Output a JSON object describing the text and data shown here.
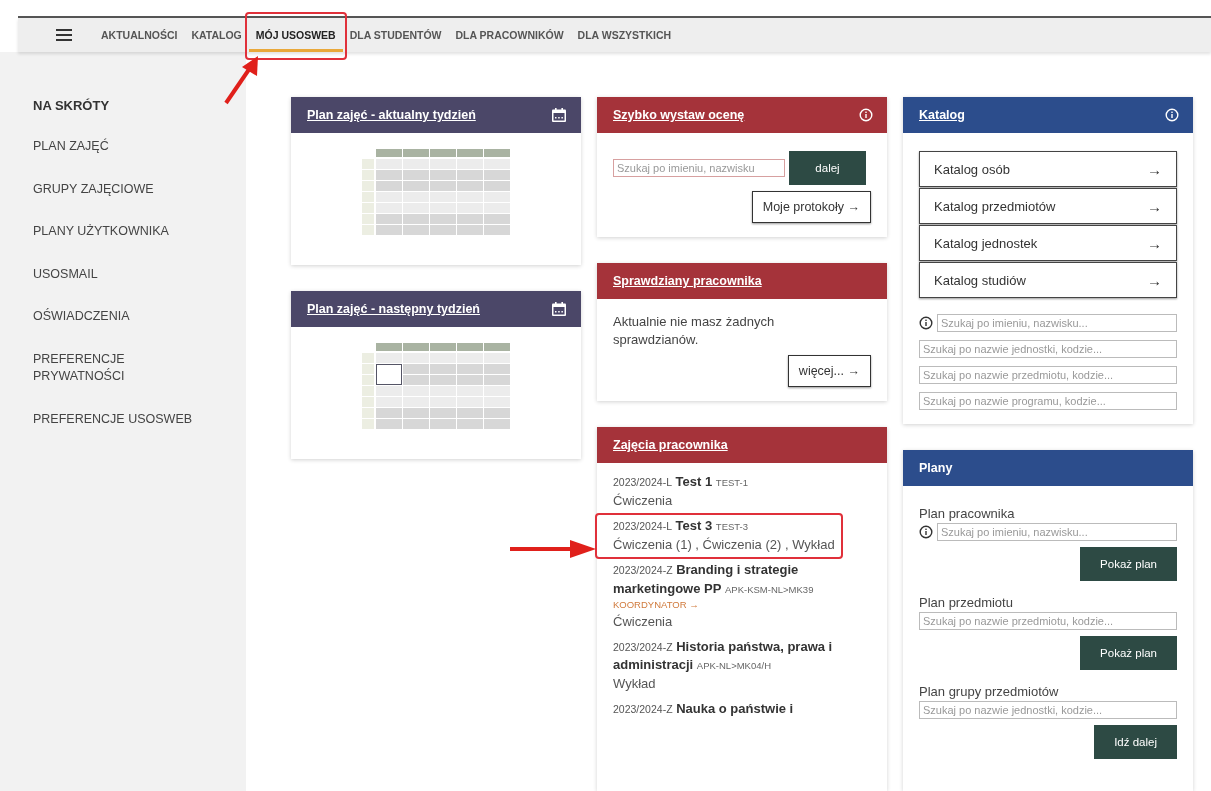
{
  "nav": {
    "items": [
      {
        "label": "AKTUALNOŚCI",
        "selected": false,
        "highlighted": false
      },
      {
        "label": "KATALOG",
        "selected": false,
        "highlighted": false
      },
      {
        "label": "MÓJ USOSWEB",
        "selected": true,
        "highlighted": true
      },
      {
        "label": "DLA STUDENTÓW",
        "selected": false,
        "highlighted": false
      },
      {
        "label": "DLA PRACOWNIKÓW",
        "selected": false,
        "highlighted": false
      },
      {
        "label": "DLA WSZYSTKICH",
        "selected": false,
        "highlighted": false
      }
    ]
  },
  "sidebar": {
    "items": [
      {
        "label": "NA SKRÓTY",
        "kind": "heading"
      },
      {
        "label": "PLAN ZAJĘĆ",
        "kind": "link"
      },
      {
        "label": "GRUPY ZAJĘCIOWE",
        "kind": "link"
      },
      {
        "label": "PLANY UŻYTKOWNIKA",
        "kind": "link"
      },
      {
        "label": "USOSMAIL",
        "kind": "link"
      },
      {
        "label": "OŚWIADCZENIA",
        "kind": "link"
      },
      {
        "label": "PREFERENCJE PRYWATNOŚCI",
        "kind": "link"
      },
      {
        "label": "PREFERENCJE USOSWEB",
        "kind": "link"
      }
    ]
  },
  "schedule_cards": [
    {
      "title": "Plan zajęć - aktualny tydzień",
      "has_event": false
    },
    {
      "title": "Plan zajęć - następny tydzień",
      "has_event": true
    }
  ],
  "quick_grade": {
    "title": "Szybko wystaw ocenę",
    "search": {
      "placeholder": "Szukaj po imieniu, nazwisku"
    },
    "go_button": "dalej",
    "protocols_button": "Moje protokoły →"
  },
  "tests": {
    "title": "Sprawdziany pracownika",
    "message": "Aktualnie nie masz żadnych sprawdzianów.",
    "more_button": "więcej... →"
  },
  "courses": {
    "title": "Zajęcia pracownika",
    "items": [
      {
        "period": "2023/2024-L",
        "name": "Test 1",
        "code": "TEST-1",
        "types": "Ćwiczenia",
        "highlighted": false
      },
      {
        "period": "2023/2024-L",
        "name": "Test 3",
        "code": "TEST-3",
        "types": "Ćwiczenia (1) , Ćwiczenia (2) , Wykład",
        "highlighted": true
      },
      {
        "period": "2023/2024-Z",
        "name": "Branding i strategie marketingowe PP",
        "code": "APK-KSM-NL>MK39",
        "role": "KOORDYNATOR →",
        "types": "Ćwiczenia",
        "highlighted": false
      },
      {
        "period": "2023/2024-Z",
        "name": "Historia państwa, prawa i administracji",
        "code": "APK-NL>MK04/H",
        "types": "Wykład",
        "highlighted": false
      },
      {
        "period": "2023/2024-Z",
        "name": "Nauka o państwie i",
        "highlighted": false
      }
    ]
  },
  "catalog": {
    "title": "Katalog",
    "buttons": [
      {
        "label": "Katalog osób",
        "arrow": "→"
      },
      {
        "label": "Katalog przedmiotów",
        "arrow": "→"
      },
      {
        "label": "Katalog jednostek",
        "arrow": "→"
      },
      {
        "label": "Katalog studiów",
        "arrow": "→"
      }
    ],
    "searches": [
      {
        "placeholder": "Szukaj po imieniu, nazwisku...",
        "info": true
      },
      {
        "placeholder": "Szukaj po nazwie jednostki, kodzie...",
        "info": false
      },
      {
        "placeholder": "Szukaj po nazwie przedmiotu, kodzie...",
        "info": false
      },
      {
        "placeholder": "Szukaj po nazwie programu, kodzie...",
        "info": false
      }
    ]
  },
  "plans": {
    "title": "Plany",
    "sections": [
      {
        "label": "Plan pracownika",
        "placeholder": "Szukaj po imieniu, nazwisku...",
        "info": true,
        "button": "Pokaż plan"
      },
      {
        "label": "Plan przedmiotu",
        "placeholder": "Szukaj po nazwie przedmiotu, kodzie...",
        "info": false,
        "button": "Pokaż plan"
      },
      {
        "label": "Plan grupy przedmiotów",
        "placeholder": "Szukaj po nazwie jednostki, kodzie...",
        "info": false,
        "button": "Idź dalej"
      }
    ]
  }
}
